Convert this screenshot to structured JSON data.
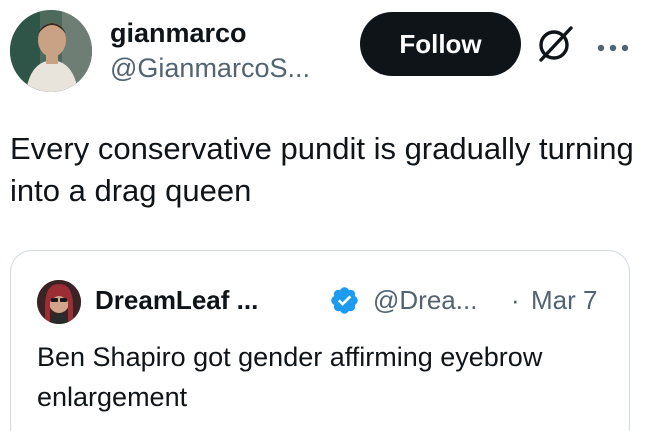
{
  "tweet": {
    "author": {
      "display_name": "gianmarco",
      "handle": "@GianmarcoS..."
    },
    "follow_label": "Follow",
    "text": "Every conservative pundit is gradually turning into a drag queen"
  },
  "quote": {
    "author": {
      "display_name": "DreamLeaf ...",
      "handle": "@Drea...",
      "verified": true
    },
    "separator": "·",
    "date": "Mar 7",
    "text": "Ben Shapiro got gender affirming eyebrow enlargement"
  },
  "icons": {
    "grok": "grok-icon",
    "more": "more-icon",
    "verified": "verified-badge-icon"
  },
  "colors": {
    "text_primary": "#0f1419",
    "text_secondary": "#536471",
    "follow_bg": "#0f1419",
    "verified_blue": "#1d9bf0",
    "border": "#cfd9de"
  }
}
